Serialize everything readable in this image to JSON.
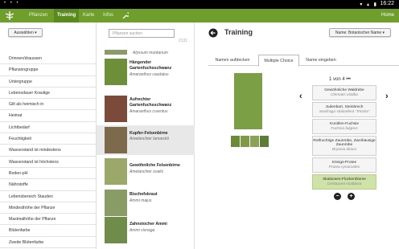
{
  "statusbar": {
    "time": "16:22",
    "icons": "▾ ▴ ▮",
    "left": "• • •"
  },
  "appbar": {
    "tabs": [
      {
        "label": "Pflanzen"
      },
      {
        "label": "Training"
      },
      {
        "label": "Karte"
      },
      {
        "label": "Infos"
      }
    ],
    "settings_icon": "wrench-icon",
    "home_label": "Home",
    "accent": "#6f9e2c"
  },
  "left": {
    "choose_button": "Auswählen ▾",
    "items": [
      "Drinnen/draussen",
      "Pflanzengruppe",
      "Untergruppe",
      "Lebensdauer Krautige",
      "Gilt als heimisch in",
      "Heimat",
      "Lichtbedarf",
      "Feuchtigkeit",
      "Wasserstand ist mindestens",
      "Wasserstand ist höchstens",
      "Boden-pH",
      "Nährstoffe",
      "Lebensbereich Stauden",
      "Mindesthöhe der Pflanze",
      "Maximalhöhe der Pflanze",
      "Blütenfarbe",
      "Zweite Blütenfarbe"
    ]
  },
  "middle": {
    "search_placeholder": "Pflanzen suchen",
    "count": "2131",
    "top_partial": "Alyssum montanum",
    "plants": [
      {
        "name1": "Hängender",
        "name2": "Gartenfuchsschwanz",
        "latin": "Amaranthus caudatus"
      },
      {
        "name1": "Aufrechter",
        "name2": "Gartenfuchsschwanz",
        "latin": "Amaranthus cruentus"
      },
      {
        "name1": "Kupfer-Felsenbirne",
        "name2": "",
        "latin": "Amelanchier lamarckii"
      },
      {
        "name1": "Gewöhnliche Felsenbirne",
        "name2": "",
        "latin": "Amelanchier ovalis"
      },
      {
        "name1": "Bischofskraut",
        "name2": "",
        "latin": "Ammi majus"
      },
      {
        "name1": "Zahnstocher Ammi",
        "name2": "",
        "latin": "Ammi visnaga"
      }
    ]
  },
  "right": {
    "title": "Training",
    "sort_button": "Name: Botanischer Name ▾",
    "tabs": [
      "Namen aufdecken",
      "Multiple Choice",
      "Name eingeben"
    ],
    "pager": "1 von 4",
    "first_icon": "⏮",
    "answers": [
      {
        "de": "Gewöhnliche Waldrebe",
        "la": "Clematis vitalba"
      },
      {
        "de": "Judenbart, Steinbrech",
        "la": "Saxifraga stolonifera 'Tricolor'"
      },
      {
        "de": "Korollen-Fuchsie",
        "la": "Fuchsia fulgens"
      },
      {
        "de": "Rotfruchtige Zaunrübe, Zweihäusige Zaunrübe",
        "la": "Bryonia dioica"
      },
      {
        "de": "Königs-Protee",
        "la": "Protea cynaroides"
      },
      {
        "de": "Skabiosen-Flockenblume",
        "la": "Centaurea scabiosa"
      }
    ],
    "minus": "−",
    "plus": "+"
  }
}
